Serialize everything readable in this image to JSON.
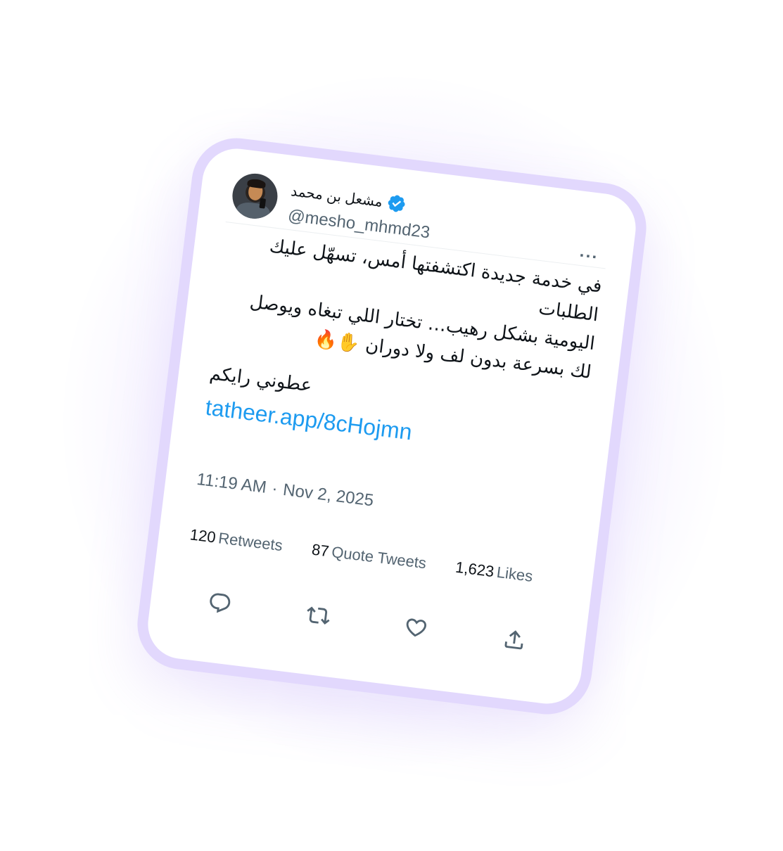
{
  "author": {
    "display_name": "مشعل بن محمد",
    "handle": "@mesho_mhmd23",
    "verified": true
  },
  "tweet": {
    "lines": [
      "في خدمة جديدة اكتشفتها أمس، تسهّل عليك الطلبات",
      "اليومية بشكل رهيب…   تختار اللي تبغاه ويوصل",
      "لك بسرعة بدون لف ولا دوران ✋🔥"
    ],
    "ask": "عطوني رايكم",
    "link": "tatheer.app/8cHojmn"
  },
  "meta": {
    "time": "11:19 AM",
    "separator": "·",
    "date": "Nov 2, 2025"
  },
  "stats": {
    "retweets_count": "120",
    "retweets_label": "Retweets",
    "quotes_count": "87",
    "quotes_label": "Quote Tweets",
    "likes_count": "1,623",
    "likes_label": "Likes"
  },
  "more_label": "···",
  "icons": {
    "verified": "verified-badge-icon",
    "reply": "reply-icon",
    "retweet": "retweet-icon",
    "like": "heart-icon",
    "share": "share-icon"
  },
  "colors": {
    "link": "#1d9bf0",
    "frame": "#e2d8fd",
    "muted": "#536471",
    "text": "#0f1419"
  }
}
